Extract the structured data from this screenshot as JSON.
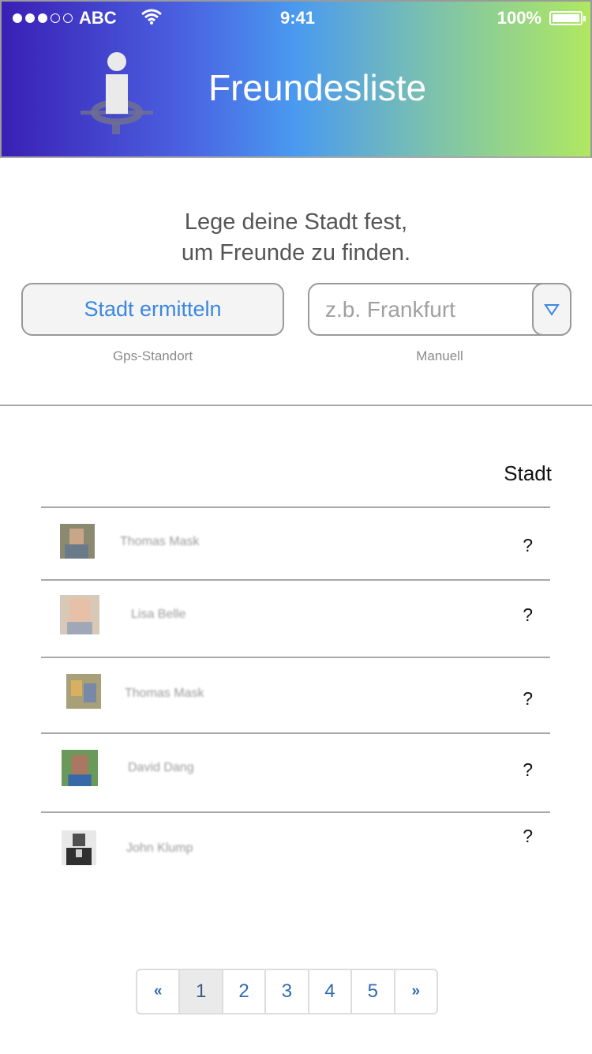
{
  "status_bar": {
    "carrier": "ABC",
    "time": "9:41",
    "battery": "100%"
  },
  "header": {
    "title": "Freundesliste",
    "logo_icon": "person-on-map-icon"
  },
  "prompt": {
    "line1": "Lege deine Stadt fest,",
    "line2": "um Freunde zu finden."
  },
  "locate_button": {
    "label": "Stadt ermitteln",
    "caption": "Gps-Standort"
  },
  "city_input": {
    "placeholder": "z.b. Frankfurt",
    "value": "",
    "caption": "Manuell"
  },
  "table": {
    "column_header": "Stadt",
    "rows": [
      {
        "name": "Thomas Mask",
        "city": "?"
      },
      {
        "name": "Lisa Belle",
        "city": "?"
      },
      {
        "name": "Thomas Mask",
        "city": "?"
      },
      {
        "name": "David Dang",
        "city": "?"
      },
      {
        "name": "John Klump",
        "city": "?"
      }
    ]
  },
  "pagination": {
    "prev": "«",
    "pages": [
      "1",
      "2",
      "3",
      "4",
      "5"
    ],
    "next": "»",
    "current": "1"
  },
  "colors": {
    "accent": "#3b87e0",
    "link": "#2f6bb0"
  }
}
